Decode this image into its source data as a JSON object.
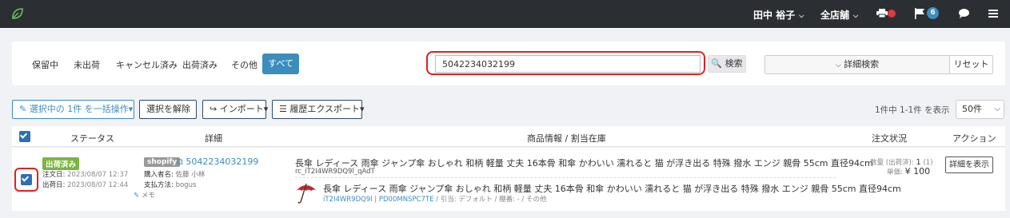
{
  "topbar": {
    "user": "田中 裕子",
    "shop": "全店舗",
    "notification_count": "6",
    "colors": {
      "bg": "#2b2e33",
      "badge": "#3c8dbc",
      "alert": "#e03b3b"
    }
  },
  "filter": {
    "tabs": [
      "保留中",
      "未出荷",
      "キャンセル済み",
      "出荷済み",
      "その他"
    ],
    "active_tab": "すべて",
    "search_value": "5042234032199",
    "search_button": "検索",
    "advanced_search": "詳細検索",
    "reset": "リセット"
  },
  "toolbar": {
    "bulk_action": "選択中の 1件 を一括操作",
    "deselect": "選択を解除",
    "import": "インポート",
    "export": "履歴エクスポート",
    "count_text": "1件中 1-1件 を表示",
    "per_page": "50件"
  },
  "table": {
    "headers": {
      "status": "ステータス",
      "detail": "詳細",
      "product": "商品情報 / 割当在庫",
      "order_status": "注文状況",
      "action": "アクション"
    },
    "rows": [
      {
        "status_badge": "出荷済み",
        "order_date_label": "注文日:",
        "order_date": "2023/08/07 12:37",
        "ship_date_label": "出荷日:",
        "ship_date": "2023/08/07 12:44",
        "channel": "shopify",
        "order_id": "5042234032199",
        "buyer_label": "購入者名:",
        "buyer": "佐藤 小林",
        "payment_label": "支払方法:",
        "payment": "bogus",
        "memo": "メモ",
        "product_title": "長傘 レディース 雨傘 ジャンプ傘 おしゃれ 和柄 軽量 丈夫 16本骨 和傘 かわいい 濡れると 猫 が浮き出る 特殊 撥水 エンジ 親骨 55cm 直径94cm",
        "product_sku": "rc_iT2I4WR9DQ9l_qAdT",
        "stock_title": "長傘 レディース 雨傘 ジャンプ傘 おしゃれ 和柄 軽量 丈夫 16本骨 和傘 かわいい 濡れると 猫 が浮き出る 特殊 撥水 エンジ 親骨 55cm 直径94cm",
        "stock_code1": "iT2I4WR9DQ9l",
        "stock_code2": "PD00MNSPC7TE",
        "stock_rest": " / 引当: デフォルト / 棚番: - / その他",
        "qty_label": "数量 (出荷済):",
        "qty": "1",
        "qty_paren": "(1)",
        "price_label": "単価:",
        "price": "¥ 100",
        "detail_button": "詳細を表示"
      }
    ]
  }
}
